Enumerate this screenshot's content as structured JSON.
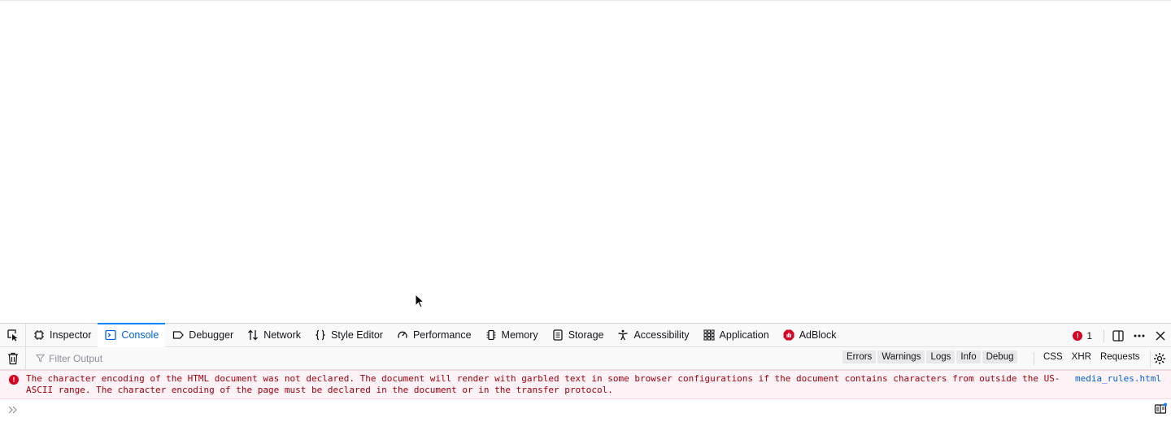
{
  "toolbar": {
    "tabs": [
      {
        "label": "Inspector",
        "icon": "inspector-icon"
      },
      {
        "label": "Console",
        "icon": "console-icon",
        "selected": true
      },
      {
        "label": "Debugger",
        "icon": "debugger-icon"
      },
      {
        "label": "Network",
        "icon": "network-icon"
      },
      {
        "label": "Style Editor",
        "icon": "style-editor-icon"
      },
      {
        "label": "Performance",
        "icon": "performance-icon"
      },
      {
        "label": "Memory",
        "icon": "memory-icon"
      },
      {
        "label": "Storage",
        "icon": "storage-icon"
      },
      {
        "label": "Accessibility",
        "icon": "accessibility-icon"
      },
      {
        "label": "Application",
        "icon": "application-icon"
      },
      {
        "label": "AdBlock",
        "icon": "adblock-icon"
      }
    ],
    "error_count": "1"
  },
  "filter": {
    "placeholder": "Filter Output",
    "levels": [
      "Errors",
      "Warnings",
      "Logs",
      "Info",
      "Debug"
    ],
    "types": [
      "CSS",
      "XHR",
      "Requests"
    ]
  },
  "messages": [
    {
      "level": "error",
      "text": "The character encoding of the HTML document was not declared. The document will render with garbled text in some browser configurations if the document contains characters from outside the US-ASCII range. The character encoding of the page must be declared in the document or in the transfer protocol.",
      "source": "media_rules.html"
    }
  ],
  "colors": {
    "accent": "#0a84ff",
    "error": "#d70022",
    "error_bg": "#fdf2f5",
    "error_text": "#a4000f"
  }
}
